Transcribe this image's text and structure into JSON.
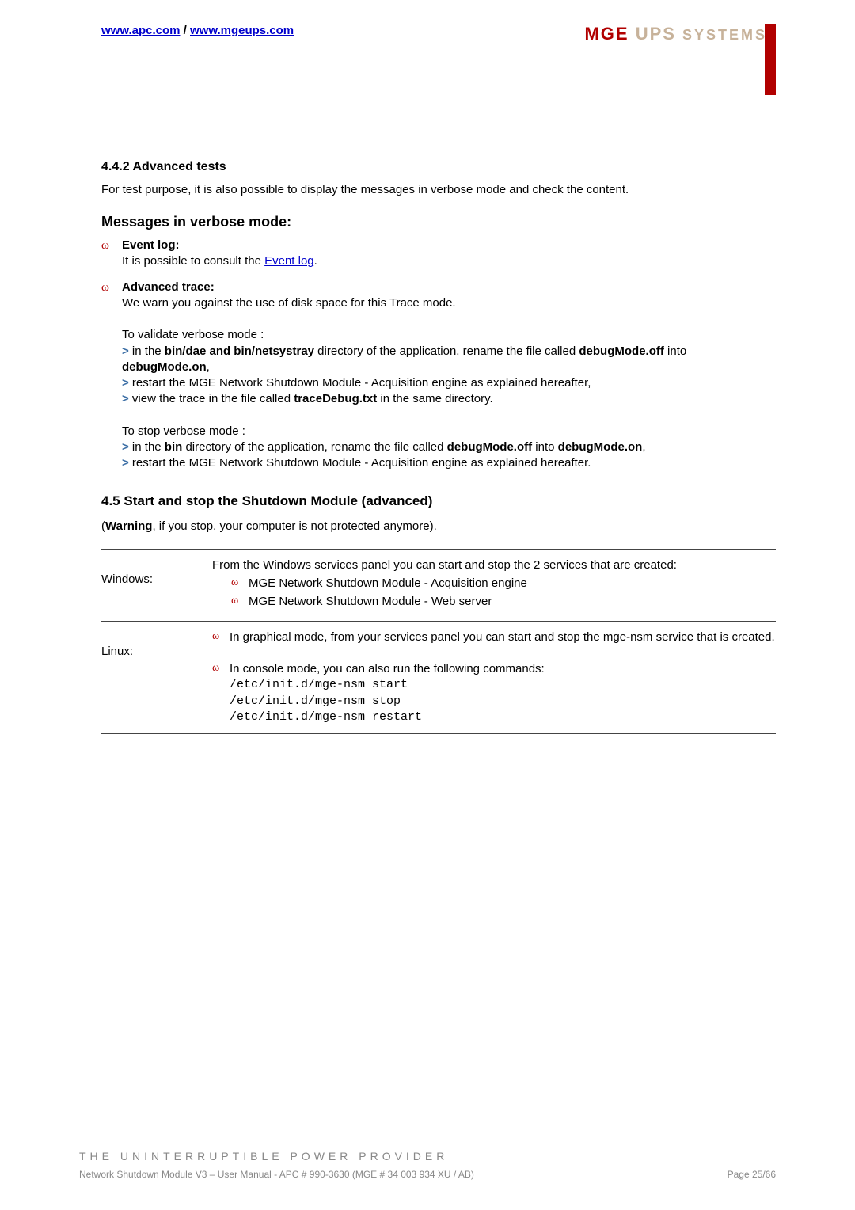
{
  "header": {
    "link1": "www.apc.com",
    "slash": " / ",
    "link2": "www.mgeups.com",
    "brand_mge": "MGE",
    "brand_ups": " UPS",
    "brand_systems": " SYSTEMS"
  },
  "section442": {
    "heading": "4.4.2   Advanced tests",
    "para1": "For test purpose, it is also possible to display the messages in verbose mode and check the content."
  },
  "messages": {
    "heading": "Messages in verbose mode:",
    "eventlog_title": "Event log:",
    "eventlog_text_a": "It is possible to consult the ",
    "eventlog_link": "Event log",
    "eventlog_text_b": ".",
    "advtrace_title": "Advanced trace:",
    "advtrace_warn": "We warn you against the use of disk space for this Trace mode.",
    "validate_heading": "To validate verbose mode :",
    "validate_l1a": " in the ",
    "validate_l1b": "bin/dae and bin/netsystray",
    "validate_l1c": " directory of the application, rename the file called ",
    "validate_l1d": "debugMode.off",
    "validate_l1e": " into ",
    "validate_l1f": "debugMode.on",
    "validate_l1g": ",",
    "validate_l2": " restart the MGE Network Shutdown Module - Acquisition engine as explained hereafter,",
    "validate_l3a": " view the trace in the file called ",
    "validate_l3b": "traceDebug.txt",
    "validate_l3c": " in the same directory.",
    "stop_heading": "To stop verbose mode :",
    "stop_l1a": " in the ",
    "stop_l1b": "bin",
    "stop_l1c": " directory of the application, rename the file called ",
    "stop_l1d": "debugMode.off",
    "stop_l1e": " into ",
    "stop_l1f": "debugMode.on",
    "stop_l1g": ",",
    "stop_l2": " restart the MGE Network Shutdown Module - Acquisition engine as explained hereafter."
  },
  "section45": {
    "heading": "4.5   Start and stop the Shutdown Module (advanced)",
    "warning_a": " (",
    "warning_b": "Warning",
    "warning_c": ", if you stop, your computer is not protected anymore)."
  },
  "table": {
    "windows_label": "Windows:",
    "windows_intro": "From the Windows services panel you can start and stop the 2 services that are created:",
    "windows_b1": "MGE Network Shutdown Module - Acquisition engine",
    "windows_b2": "MGE Network Shutdown Module - Web server",
    "linux_label": "Linux:",
    "linux_b1": "In graphical mode, from your services panel you can start and stop the mge-nsm service that is created.",
    "linux_b2": "In console mode, you can also run the following commands:",
    "linux_cmd1": "/etc/init.d/mge-nsm start",
    "linux_cmd2": "/etc/init.d/mge-nsm stop",
    "linux_cmd3": "/etc/init.d/mge-nsm restart"
  },
  "footer": {
    "tagline": "THE UNINTERRUPTIBLE POWER PROVIDER",
    "left": "Network Shutdown Module V3 – User Manual - APC # 990-3630 (MGE # 34 003 934 XU / AB)",
    "right": "Page 25/66"
  },
  "glyph": {
    "omega": "ω",
    "gt": ">"
  }
}
